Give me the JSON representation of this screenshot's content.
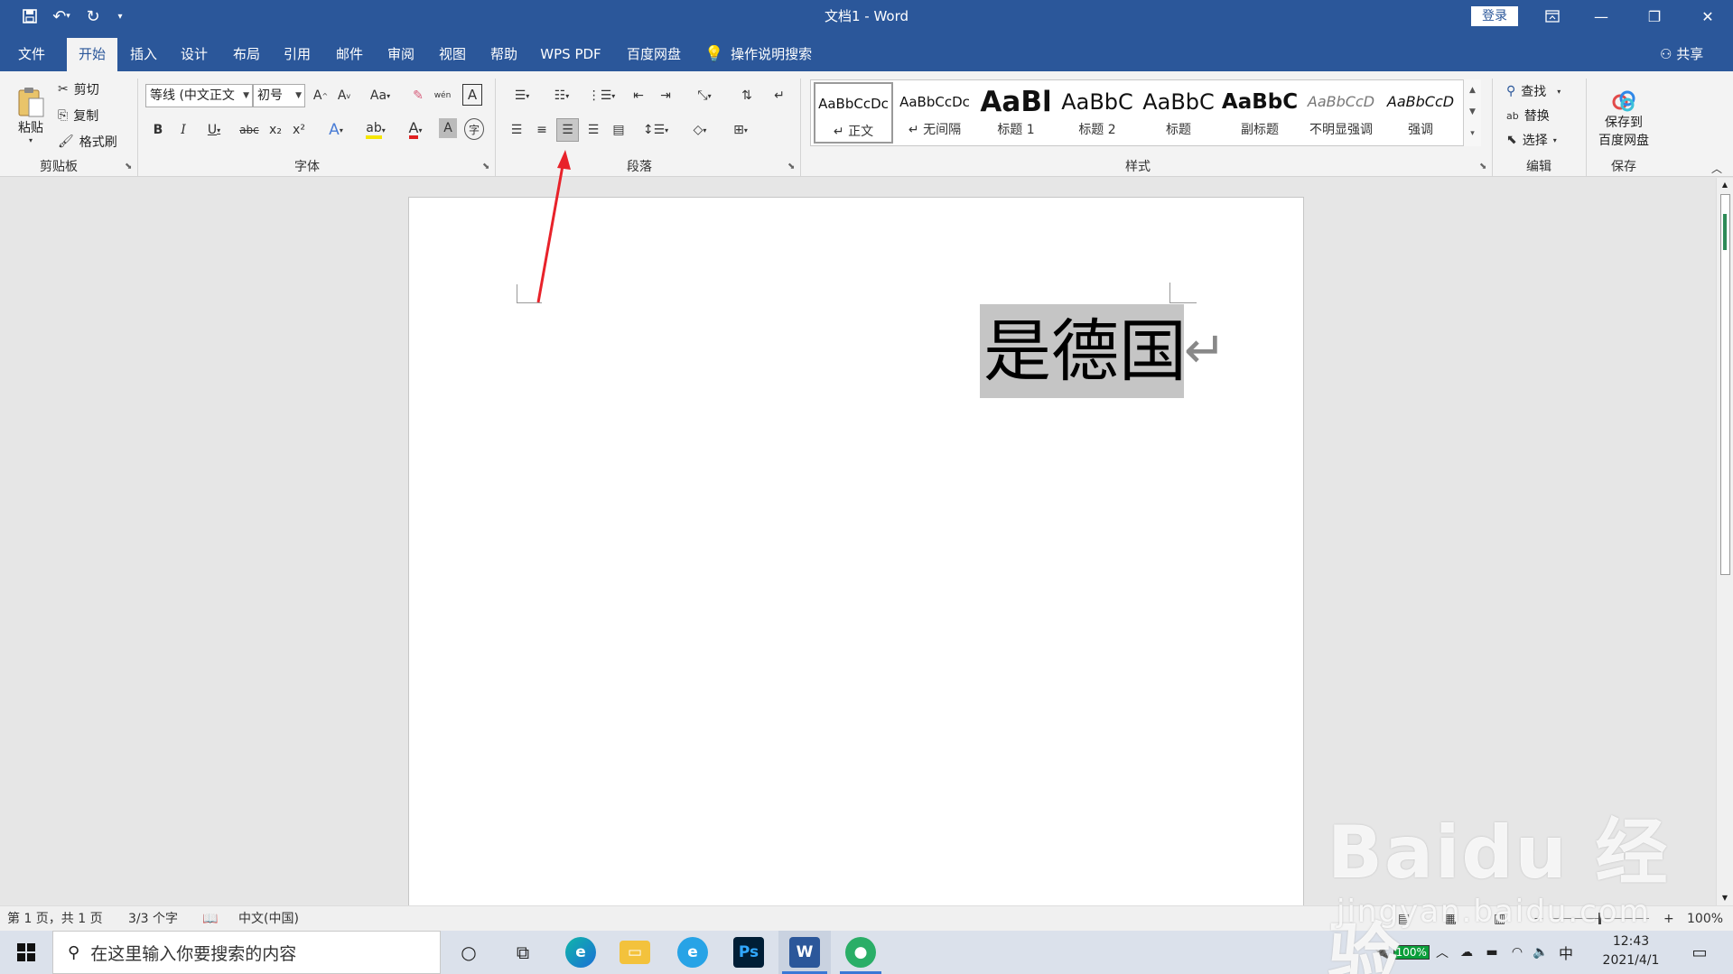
{
  "window": {
    "title": "文档1  -  Word",
    "login_label": "登录"
  },
  "quick_access": {
    "save_icon": "save-icon",
    "undo_icon": "undo-icon",
    "redo_icon": "redo-icon",
    "customize_icon": "customize-icon"
  },
  "tabs": [
    {
      "label": "文件",
      "active": false
    },
    {
      "label": "开始",
      "active": true
    },
    {
      "label": "插入",
      "active": false
    },
    {
      "label": "设计",
      "active": false
    },
    {
      "label": "布局",
      "active": false
    },
    {
      "label": "引用",
      "active": false
    },
    {
      "label": "邮件",
      "active": false
    },
    {
      "label": "审阅",
      "active": false
    },
    {
      "label": "视图",
      "active": false
    },
    {
      "label": "帮助",
      "active": false
    },
    {
      "label": "WPS PDF",
      "active": false
    },
    {
      "label": "百度网盘",
      "active": false
    }
  ],
  "tell_me": "操作说明搜索",
  "share_label": "共享",
  "ribbon": {
    "clipboard": {
      "group": "剪贴板",
      "paste": "粘贴",
      "cut": "剪切",
      "copy": "复制",
      "format_painter": "格式刷"
    },
    "font": {
      "group": "字体",
      "font_name": "等线 (中文正文",
      "font_size": "初号",
      "bold": "B",
      "italic": "I",
      "underline": "U",
      "strike": "abc",
      "subscript": "x₂",
      "superscript": "x²",
      "change_case": "Aa",
      "grow": "A˄",
      "shrink": "A˅",
      "pinyin": "wén"
    },
    "paragraph": {
      "group": "段落",
      "align_right_active": true
    },
    "styles": {
      "group": "样式",
      "items": [
        {
          "preview": "AaBbCcDc",
          "name": "↵ 正文",
          "selected": true
        },
        {
          "preview": "AaBbCcDc",
          "name": "↵ 无间隔",
          "selected": false
        },
        {
          "preview": "AaBl",
          "name": "标题 1",
          "selected": false
        },
        {
          "preview": "AaBbC",
          "name": "标题 2",
          "selected": false
        },
        {
          "preview": "AaBbC",
          "name": "标题",
          "selected": false
        },
        {
          "preview": "AaBbC",
          "name": "副标题",
          "selected": false
        },
        {
          "preview": "AaBbCcD",
          "name": "不明显强调",
          "selected": false
        },
        {
          "preview": "AaBbCcD",
          "name": "强调",
          "selected": false
        }
      ]
    },
    "editing": {
      "group": "编辑",
      "find": "查找",
      "replace": "替换",
      "select": "选择"
    },
    "save": {
      "group": "保存",
      "save_to_baidu_1": "保存到",
      "save_to_baidu_2": "百度网盘"
    }
  },
  "document": {
    "text": "是德国",
    "paragraph_mark": "↵"
  },
  "statusbar": {
    "page": "第 1 页，共 1 页",
    "words": "3/3 个字",
    "language": "中文(中国)",
    "zoom": "100%",
    "zoom_minus": "−",
    "zoom_plus": "+"
  },
  "taskbar": {
    "search_placeholder": "在这里输入你要搜索的内容",
    "battery": "100%",
    "ime": "中",
    "time": "12:43",
    "date": "2021/4/1"
  },
  "watermark": {
    "logo": "Baidu 经验",
    "url": "jingyan.baidu.com"
  }
}
